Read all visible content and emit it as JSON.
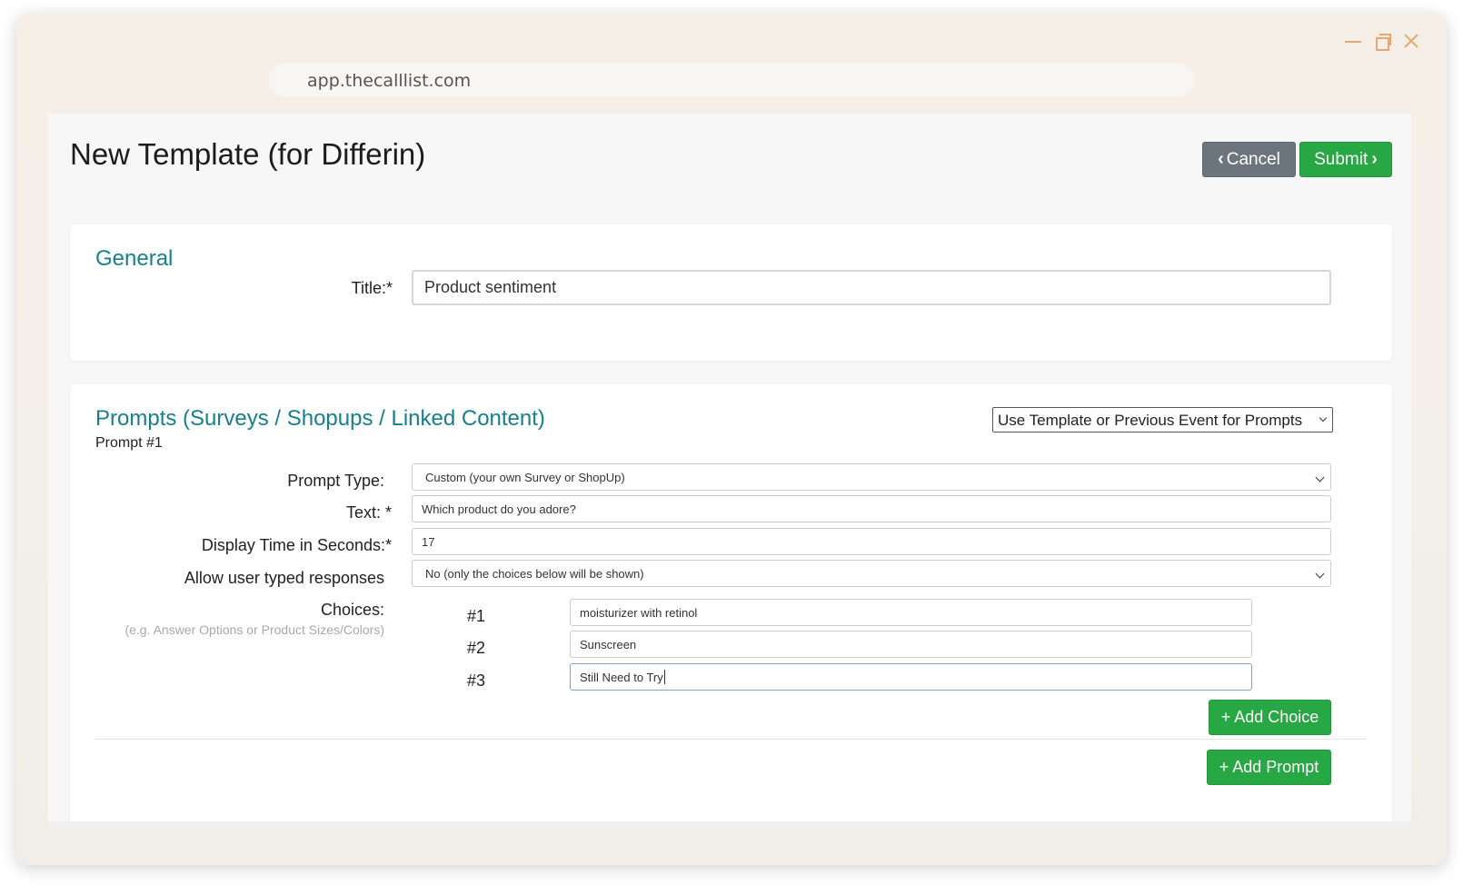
{
  "browser": {
    "url": "app.thecalllist.com"
  },
  "header": {
    "title": "New Template (for Differin)",
    "cancel_label": "Cancel",
    "submit_label": "Submit"
  },
  "general": {
    "heading": "General",
    "title_label": "Title:*",
    "title_value": "Product sentiment"
  },
  "prompts": {
    "heading": "Prompts (Surveys / Shopups / Linked Content)",
    "template_select": "Use Template or Previous Event for Prompts",
    "prompt_number": "Prompt #1",
    "prompt_type_label": "Prompt Type:",
    "prompt_type_value": "Custom (your own Survey or ShopUp)",
    "text_label": "Text: *",
    "text_value": "Which product do you adore?",
    "display_time_label": "Display Time in Seconds:*",
    "display_time_value": "17",
    "typed_label": "Allow user typed responses",
    "typed_value": "No (only the choices below will be shown)",
    "choices_label": "Choices:",
    "choices_hint": "(e.g. Answer Options or Product Sizes/Colors)",
    "choices": [
      {
        "number": "#1",
        "value": "moisturizer with retinol"
      },
      {
        "number": "#2",
        "value": "Sunscreen"
      },
      {
        "number": "#3",
        "value": "Still Need to Try"
      }
    ],
    "add_choice_label": "+ Add Choice",
    "add_prompt_label": "+ Add Prompt"
  },
  "colors": {
    "accent": "#17808a",
    "success": "#28a745",
    "secondary": "#6c757d",
    "window_control": "#e3a874"
  }
}
